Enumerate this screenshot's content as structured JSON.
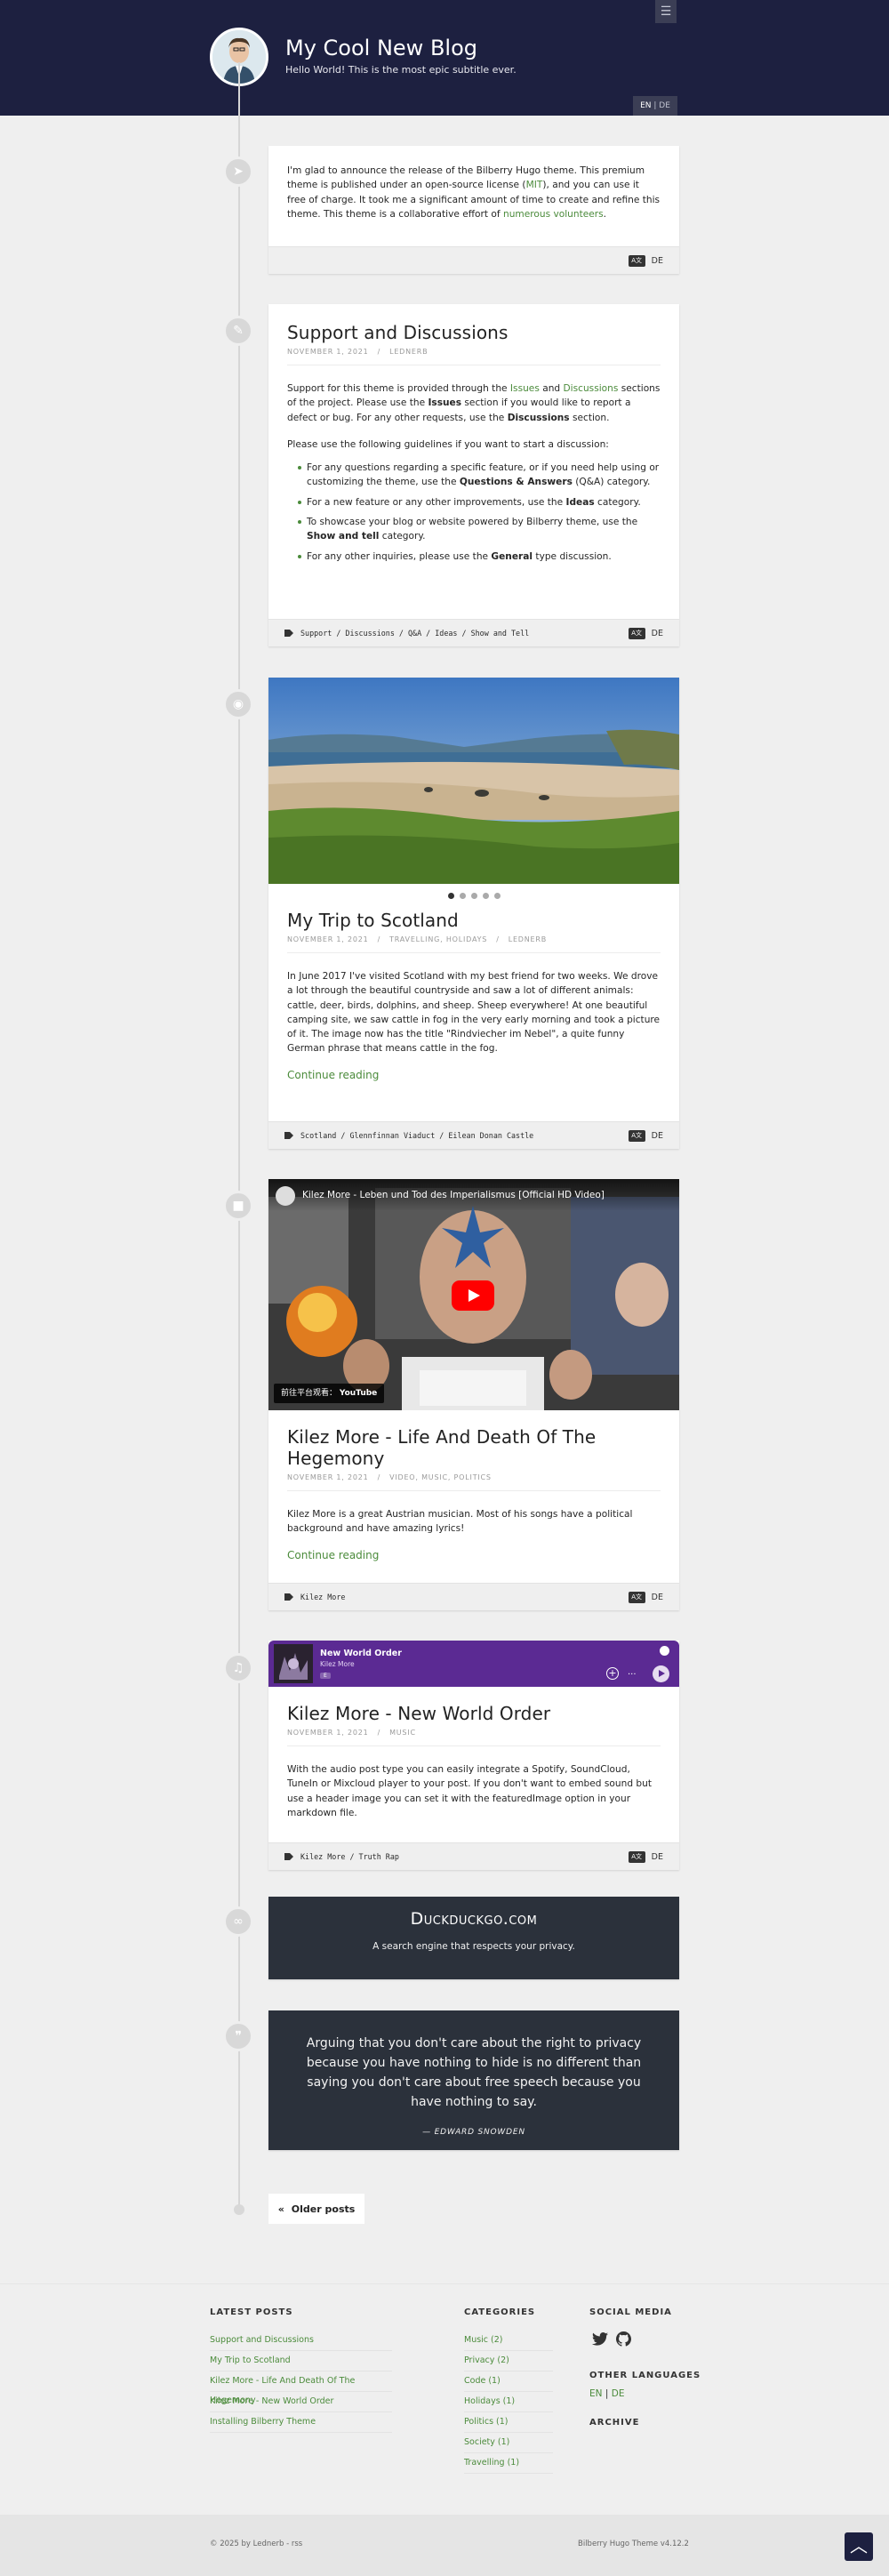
{
  "site": {
    "title": "My Cool New Blog",
    "subtitle": "Hello World! This is the most epic subtitle ever.",
    "lang_active": "EN",
    "lang_sep": "|",
    "lang_other": "DE"
  },
  "posts": [
    {
      "type": "announcement",
      "icon": "paper-plane-icon",
      "text_parts": [
        "I'm glad to announce the release of the Bilberry Hugo theme. This premium theme is published under an open-source license (",
        "MIT",
        "), and you can use it free of charge. It took me a significant amount of time to create and refine this theme. This theme is a collaborative effort of ",
        "numerous volunteers",
        "."
      ],
      "translation": "DE"
    },
    {
      "type": "article",
      "icon": "pencil-icon",
      "title": "Support and Discussions",
      "date": "NOVEMBER 1, 2021",
      "meta_sep": "/",
      "author": "LEDNERB",
      "p1": [
        "Support for this theme is provided through the ",
        "Issues",
        " and ",
        "Discussions",
        " sections of the project. Please use the ",
        "Issues",
        " section if you would like to report a defect or bug. For any other requests, use the ",
        "Discussions",
        " section."
      ],
      "p2": "Please use the following guidelines if you want to start a discussion:",
      "list": [
        [
          "For any questions regarding a specific feature, or if you need help using or customizing the theme, use the ",
          "Questions & Answers",
          " (Q&A) category."
        ],
        [
          "For a new feature or any other improvements, use the ",
          "Ideas",
          " category."
        ],
        [
          "To showcase your blog or website powered by Bilberry theme, use the ",
          "Show and tell",
          " category."
        ],
        [
          "For any other inquiries, please use the ",
          "General",
          " type discussion."
        ]
      ],
      "tags": "Support / Discussions / Q&A / Ideas / Show and Tell",
      "translation": "DE"
    },
    {
      "type": "gallery",
      "icon": "camera-icon",
      "title": "My Trip to Scotland",
      "date": "NOVEMBER 1, 2021",
      "meta_sep": "/",
      "categories": "TRAVELLING, HOLIDAYS",
      "author": "LEDNERB",
      "text": "In June 2017 I've visited Scotland with my best friend for two weeks. We drove a lot through the beautiful countryside and saw a lot of different animals: cattle, deer, birds, dolphins, and sheep. Sheep everywhere! At one beautiful camping site, we saw cattle in fog in the very early morning and took a picture of it. The image now has the title \"Rindviecher im Nebel\", a quite funny German phrase that means cattle in the fog.",
      "read_more": "Continue reading",
      "tags": "Scotland / Glennfinnan Viaduct / Eilean Donan Castle",
      "translation": "DE",
      "slides": 5
    },
    {
      "type": "video",
      "icon": "video-icon",
      "video_title": "Kilez More - Leben und Tod des Imperialismus [Official HD Video]",
      "video_badge": "前往平台观看：",
      "video_platform": "YouTube",
      "title": "Kilez More - Life And Death Of The Hegemony",
      "date": "NOVEMBER 1, 2021",
      "meta_sep": "/",
      "categories": "VIDEO, MUSIC, POLITICS",
      "text": "Kilez More is a great Austrian musician. Most of his songs have a political background and have amazing lyrics!",
      "read_more": "Continue reading",
      "tags": "Kilez More",
      "translation": "DE"
    },
    {
      "type": "audio",
      "icon": "music-icon",
      "player_track": "New World Order",
      "player_artist": "Kilez More",
      "player_badge": "E",
      "title": "Kilez More - New World Order",
      "date": "NOVEMBER 1, 2021",
      "meta_sep": "/",
      "categories": "MUSIC",
      "text": "With the audio post type you can easily integrate a Spotify, SoundCloud, TuneIn or Mixcloud player to your post. If you don't want to embed sound but use a header image you can set it with the featuredImage option in your markdown file.",
      "tags": "Kilez More / Truth Rap",
      "translation": "DE"
    },
    {
      "type": "link",
      "icon": "link-icon",
      "link_title": "Duckduckgo.com",
      "link_sub": "A search engine that respects your privacy."
    },
    {
      "type": "quote",
      "icon": "quote-icon",
      "quote": "Arguing that you don't care about the right to privacy because you have nothing to hide is no different than saying you don't care about free speech because you have nothing to say.",
      "author": "— EDWARD SNOWDEN"
    }
  ],
  "pagination": {
    "older": "Older posts"
  },
  "footer": {
    "latest_title": "LATEST POSTS",
    "latest": [
      "Support and Discussions",
      "My Trip to Scotland",
      "Kilez More - Life And Death Of The Hegemony",
      "Kilez More - New World Order",
      "Installing Bilberry Theme"
    ],
    "categories_title": "CATEGORIES",
    "categories": [
      "Music (2)",
      "Privacy (2)",
      "Code (1)",
      "Holidays (1)",
      "Politics (1)",
      "Society (1)",
      "Travelling (1)"
    ],
    "social_title": "SOCIAL MEDIA",
    "languages_title": "OTHER LANGUAGES",
    "lang_en": "EN",
    "lang_sep": "|",
    "lang_de": "DE",
    "archive_title": "ARCHIVE",
    "copyright": "© 2025 by Lednerb - rss",
    "theme": "Bilberry Hugo Theme v4.12.2"
  },
  "colors": {
    "header": "#1d2040",
    "accent": "#4b8b3b",
    "dark_card": "#2b313b",
    "player": "#5b2a93"
  }
}
